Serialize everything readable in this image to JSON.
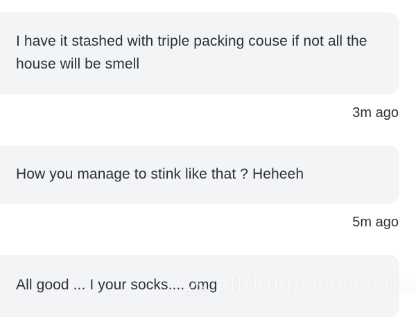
{
  "messages": [
    {
      "text": "I have it stashed with triple packing couse if not all the house will be smell",
      "time": "3m ago"
    },
    {
      "text": "How you manage to stink like that ? Heheeh",
      "time": "5m ago"
    },
    {
      "text": "All good ... I your socks.... omg",
      "time": ""
    }
  ],
  "watermark": {
    "text": "allthingsworn.com",
    "icon": "hanger-icon"
  },
  "colors": {
    "bubble": "#f3f4f6",
    "text": "#2b2f38",
    "background": "#ffffff"
  }
}
